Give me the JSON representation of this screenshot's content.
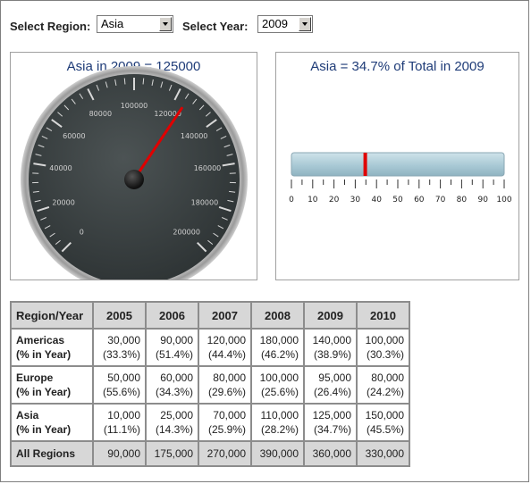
{
  "controls": {
    "region_label": "Select Region:",
    "region_value": "Asia",
    "year_label": "Select Year:",
    "year_value": "2009"
  },
  "gauge": {
    "title": "Asia in 2009 = 125000",
    "value": 125000,
    "min": 0,
    "max": 200000,
    "tick_labels": [
      "0",
      "20000",
      "40000",
      "60000",
      "80000",
      "100000",
      "120000",
      "140000",
      "160000",
      "180000",
      "200000"
    ]
  },
  "bullet": {
    "title": "Asia = 34.7% of Total in 2009",
    "value": 34.7,
    "min": 0,
    "max": 100,
    "tick_labels": [
      "0",
      "10",
      "20",
      "30",
      "40",
      "50",
      "60",
      "70",
      "80",
      "90",
      "100"
    ]
  },
  "table": {
    "corner": "Region/Year",
    "years": [
      "2005",
      "2006",
      "2007",
      "2008",
      "2009",
      "2010"
    ],
    "rows": [
      {
        "name": "Americas",
        "sub": "(% in Year)",
        "values": [
          "30,000",
          "90,000",
          "120,000",
          "180,000",
          "140,000",
          "100,000"
        ],
        "pcts": [
          "(33.3%)",
          "(51.4%)",
          "(44.4%)",
          "(46.2%)",
          "(38.9%)",
          "(30.3%)"
        ]
      },
      {
        "name": "Europe",
        "sub": "(% in Year)",
        "values": [
          "50,000",
          "60,000",
          "80,000",
          "100,000",
          "95,000",
          "80,000"
        ],
        "pcts": [
          "(55.6%)",
          "(34.3%)",
          "(29.6%)",
          "(25.6%)",
          "(26.4%)",
          "(24.2%)"
        ]
      },
      {
        "name": "Asia",
        "sub": "(% in Year)",
        "values": [
          "10,000",
          "25,000",
          "70,000",
          "110,000",
          "125,000",
          "150,000"
        ],
        "pcts": [
          "(11.1%)",
          "(14.3%)",
          "(25.9%)",
          "(28.2%)",
          "(34.7%)",
          "(45.5%)"
        ]
      }
    ],
    "total": {
      "name": "All Regions",
      "values": [
        "90,000",
        "175,000",
        "270,000",
        "390,000",
        "360,000",
        "330,000"
      ]
    }
  }
}
